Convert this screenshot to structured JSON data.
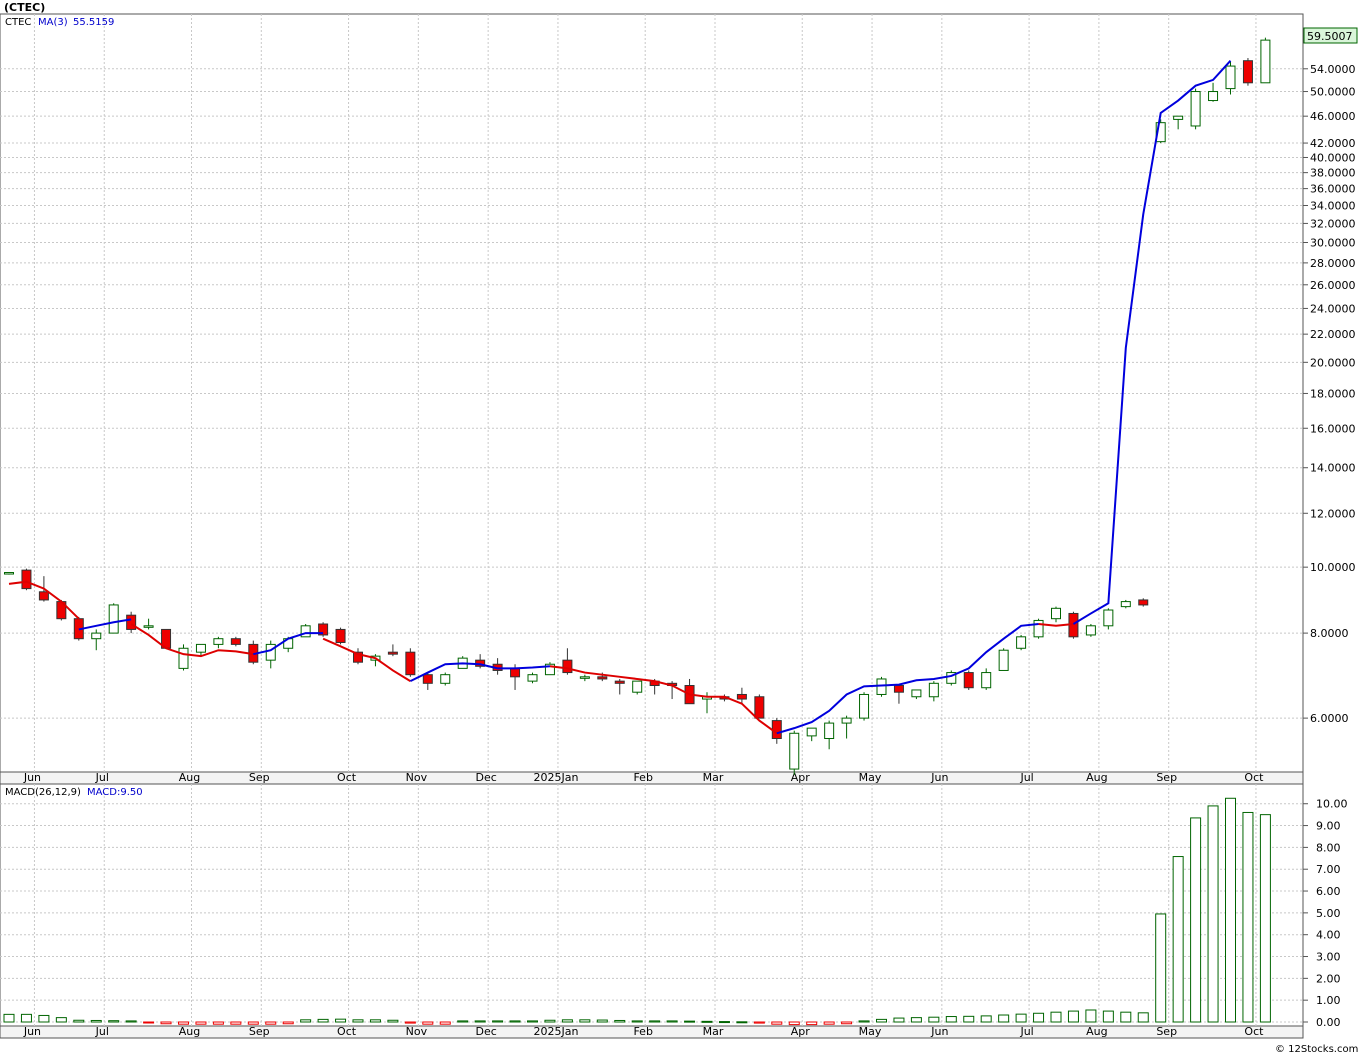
{
  "header": {
    "title": "(CTEC)",
    "legend_symbol": "CTEC",
    "ma_label": "MA(3)",
    "ma_value": "55.5159",
    "macd_label": "MACD(26,12,9)",
    "macd_value": "MACD:9.50",
    "last_price": "59.5007",
    "credit": "© 12Stocks.com"
  },
  "colors": {
    "up_fill": "#ffffff",
    "up_stroke": "#006400",
    "down_fill": "#ee0000",
    "ma_rising": "#0000dd",
    "ma_falling": "#dd0000",
    "price_tag_bg": "#d9f5d9"
  },
  "chart_data": [
    {
      "type": "candlestick",
      "scale": "log",
      "ylim": [
        5,
        65
      ],
      "y_ticks": [
        "6.0000",
        "8.0000",
        "10.0000",
        "12.0000",
        "14.0000",
        "16.0000",
        "18.0000",
        "20.0000",
        "22.0000",
        "24.0000",
        "26.0000",
        "28.0000",
        "30.0000",
        "32.0000",
        "34.0000",
        "36.0000",
        "38.0000",
        "40.0000",
        "42.0000",
        "46.0000",
        "50.0000",
        "54.0000"
      ],
      "x_labels": [
        "Jun",
        "Jul",
        "Aug",
        "Sep",
        "Oct",
        "Nov",
        "Dec",
        "2025Jan",
        "Feb",
        "Mar",
        "Apr",
        "May",
        "Jun",
        "Jul",
        "Aug",
        "Sep",
        "Oct"
      ],
      "candles": [
        [
          9.8,
          9.82,
          9.75,
          9.82
        ],
        [
          9.9,
          9.95,
          9.25,
          9.3
        ],
        [
          9.2,
          9.7,
          8.9,
          8.95
        ],
        [
          8.9,
          8.95,
          8.35,
          8.4
        ],
        [
          8.4,
          8.45,
          7.8,
          7.85
        ],
        [
          7.85,
          8.1,
          7.55,
          8.0
        ],
        [
          8.0,
          8.85,
          8.0,
          8.8
        ],
        [
          8.5,
          8.6,
          8.0,
          8.1
        ],
        [
          8.2,
          8.4,
          8.1,
          8.2
        ],
        [
          8.1,
          8.1,
          7.6,
          7.6
        ],
        [
          7.1,
          7.7,
          7.05,
          7.6
        ],
        [
          7.5,
          7.7,
          7.4,
          7.7
        ],
        [
          7.7,
          7.9,
          7.6,
          7.85
        ],
        [
          7.85,
          7.9,
          7.65,
          7.7
        ],
        [
          7.7,
          7.8,
          7.2,
          7.25
        ],
        [
          7.3,
          7.8,
          7.1,
          7.7
        ],
        [
          7.6,
          7.9,
          7.5,
          7.85
        ],
        [
          7.9,
          8.25,
          7.9,
          8.2
        ],
        [
          8.25,
          8.3,
          7.9,
          7.95
        ],
        [
          8.1,
          8.15,
          7.7,
          7.75
        ],
        [
          7.5,
          7.6,
          7.2,
          7.25
        ],
        [
          7.3,
          7.45,
          7.15,
          7.4
        ],
        [
          7.5,
          7.7,
          7.4,
          7.45
        ],
        [
          7.5,
          7.6,
          6.9,
          6.95
        ],
        [
          6.95,
          7.0,
          6.6,
          6.75
        ],
        [
          6.75,
          7.0,
          6.7,
          6.95
        ],
        [
          7.1,
          7.4,
          7.1,
          7.35
        ],
        [
          7.3,
          7.45,
          7.1,
          7.15
        ],
        [
          7.2,
          7.35,
          6.95,
          7.05
        ],
        [
          7.1,
          7.2,
          6.6,
          6.9
        ],
        [
          6.8,
          7.0,
          6.75,
          6.95
        ],
        [
          6.95,
          7.25,
          6.95,
          7.2
        ],
        [
          7.3,
          7.6,
          6.95,
          7.0
        ],
        [
          6.9,
          6.95,
          6.8,
          6.9
        ],
        [
          6.9,
          7.0,
          6.8,
          6.85
        ],
        [
          6.8,
          6.85,
          6.5,
          6.75
        ],
        [
          6.55,
          6.8,
          6.5,
          6.8
        ],
        [
          6.8,
          6.85,
          6.5,
          6.7
        ],
        [
          6.75,
          6.8,
          6.4,
          6.7
        ],
        [
          6.7,
          6.85,
          6.3,
          6.3
        ],
        [
          6.4,
          6.55,
          6.1,
          6.45
        ],
        [
          6.45,
          6.5,
          6.35,
          6.4
        ],
        [
          6.5,
          6.65,
          6.3,
          6.4
        ],
        [
          6.45,
          6.5,
          6.0,
          6.0
        ],
        [
          5.95,
          6.0,
          5.5,
          5.6
        ],
        [
          5.05,
          5.75,
          4.95,
          5.7
        ],
        [
          5.65,
          5.8,
          5.55,
          5.8
        ],
        [
          5.6,
          5.95,
          5.4,
          5.9
        ],
        [
          5.9,
          6.05,
          5.6,
          6.0
        ],
        [
          6.0,
          6.55,
          5.95,
          6.5
        ],
        [
          6.5,
          6.9,
          6.45,
          6.85
        ],
        [
          6.7,
          6.7,
          6.3,
          6.55
        ],
        [
          6.45,
          6.6,
          6.4,
          6.6
        ],
        [
          6.45,
          6.8,
          6.35,
          6.75
        ],
        [
          6.75,
          7.05,
          6.7,
          7.0
        ],
        [
          7.0,
          7.05,
          6.6,
          6.65
        ],
        [
          6.65,
          7.1,
          6.6,
          7.0
        ],
        [
          7.05,
          7.6,
          7.05,
          7.55
        ],
        [
          7.6,
          7.95,
          7.55,
          7.9
        ],
        [
          7.9,
          8.4,
          7.85,
          8.35
        ],
        [
          8.4,
          8.75,
          8.3,
          8.7
        ],
        [
          8.55,
          8.6,
          7.85,
          7.9
        ],
        [
          7.95,
          8.25,
          7.9,
          8.2
        ],
        [
          8.2,
          8.7,
          8.1,
          8.65
        ],
        [
          8.75,
          8.95,
          8.7,
          8.9
        ],
        [
          8.95,
          9.0,
          8.75,
          8.8
        ],
        [
          42.2,
          45.5,
          42.0,
          45.0
        ],
        [
          45.5,
          46.0,
          44.0,
          46.0
        ],
        [
          44.5,
          50.5,
          44.0,
          50.0
        ],
        [
          48.5,
          51.5,
          48.3,
          50.0
        ],
        [
          50.5,
          55.3,
          49.5,
          54.5
        ],
        [
          55.5,
          56.0,
          51.0,
          51.5
        ],
        [
          51.5,
          60.0,
          51.5,
          59.5
        ]
      ],
      "ma_segments": [
        {
          "color": "red",
          "values": [
            9.45,
            9.52,
            9.3,
            8.9,
            8.4
          ]
        },
        {
          "color": "blue",
          "values": [
            8.1,
            8.2,
            8.3,
            8.38
          ]
        },
        {
          "color": "red",
          "values": [
            8.25,
            7.95,
            7.6,
            7.45,
            7.4,
            7.55,
            7.52,
            7.45
          ]
        },
        {
          "color": "blue",
          "values": [
            7.45,
            7.55,
            7.85,
            8.0,
            8.0
          ]
        },
        {
          "color": "red",
          "values": [
            7.85,
            7.65,
            7.45,
            7.35,
            7.05,
            6.8
          ]
        },
        {
          "color": "blue",
          "values": [
            6.8,
            7.0,
            7.2,
            7.22,
            7.2,
            7.1,
            7.1,
            7.12,
            7.15
          ]
        },
        {
          "color": "red",
          "values": [
            7.15,
            7.1,
            7.0,
            6.95,
            6.9,
            6.85,
            6.8,
            6.7,
            6.5,
            6.45,
            6.45,
            6.3,
            5.95,
            5.7
          ]
        },
        {
          "color": "blue",
          "values": [
            5.7,
            5.8,
            5.92,
            6.15,
            6.5,
            6.68,
            6.7,
            6.72,
            6.82,
            6.85,
            6.92,
            7.1,
            7.5,
            7.85,
            8.2,
            8.25
          ]
        },
        {
          "color": "red",
          "values": [
            8.25,
            8.2,
            8.25
          ]
        },
        {
          "color": "blue",
          "values": [
            8.25,
            8.55,
            8.85,
            21.0,
            33.0,
            46.5,
            48.5,
            51.0,
            52.0,
            55.5
          ]
        }
      ]
    },
    {
      "type": "bar",
      "title": "MACD(26,12,9)",
      "ylim": [
        0,
        10.4
      ],
      "y_ticks": [
        "0.00",
        "1.00",
        "2.00",
        "3.00",
        "4.00",
        "5.00",
        "6.00",
        "7.00",
        "8.00",
        "9.00",
        "10.00"
      ],
      "x_labels": [
        "Jun",
        "Jul",
        "Aug",
        "Sep",
        "Oct",
        "Nov",
        "Dec",
        "2025Jan",
        "Feb",
        "Mar",
        "Apr",
        "May",
        "Jun",
        "Jul",
        "Aug",
        "Sep",
        "Oct"
      ],
      "values": [
        0.35,
        0.35,
        0.3,
        0.2,
        0.08,
        0.07,
        0.06,
        0.05,
        -0.02,
        -0.08,
        -0.1,
        -0.1,
        -0.1,
        -0.1,
        -0.1,
        -0.1,
        -0.08,
        0.1,
        0.12,
        0.13,
        0.1,
        0.1,
        0.08,
        -0.05,
        -0.1,
        -0.1,
        0.05,
        0.05,
        0.05,
        0.05,
        0.05,
        0.08,
        0.1,
        0.1,
        0.09,
        0.07,
        0.05,
        0.05,
        0.05,
        0.04,
        0.03,
        0.02,
        0.01,
        -0.05,
        -0.1,
        -0.12,
        -0.12,
        -0.1,
        -0.08,
        0.05,
        0.12,
        0.18,
        0.2,
        0.22,
        0.25,
        0.26,
        0.28,
        0.32,
        0.36,
        0.4,
        0.45,
        0.5,
        0.55,
        0.5,
        0.45,
        0.42,
        4.95,
        7.58,
        9.35,
        9.9,
        10.25,
        9.6,
        9.5
      ]
    }
  ]
}
